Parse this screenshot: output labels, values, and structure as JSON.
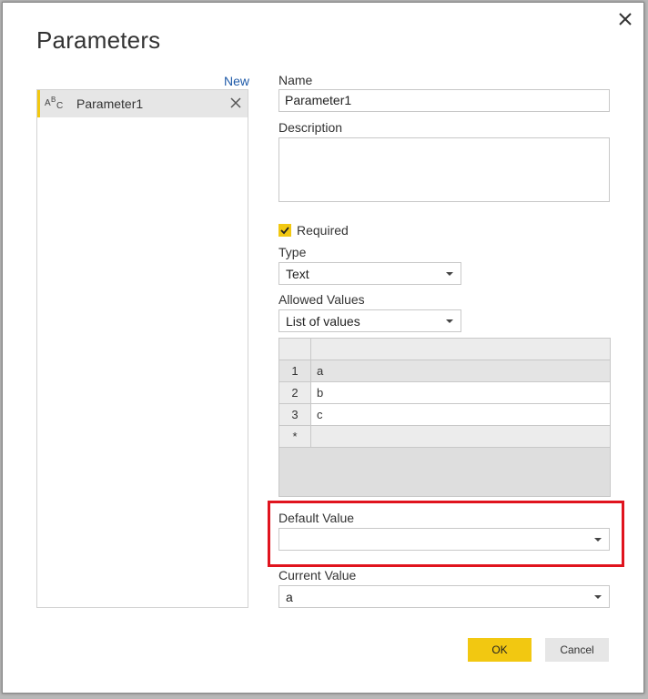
{
  "dialog": {
    "title": "Parameters",
    "new_link": "New"
  },
  "parameters": [
    {
      "name": "Parameter1",
      "type_icon": "text-type-icon",
      "icon_text": [
        "A",
        "B",
        "C"
      ]
    }
  ],
  "form": {
    "name_label": "Name",
    "name_value": "Parameter1",
    "description_label": "Description",
    "description_value": "",
    "required_label": "Required",
    "required_checked": true,
    "type_label": "Type",
    "type_value": "Text",
    "allowed_values_label": "Allowed Values",
    "allowed_values_value": "List of values",
    "values_grid": {
      "rows": [
        {
          "num": "1",
          "value": "a",
          "selected": true
        },
        {
          "num": "2",
          "value": "b"
        },
        {
          "num": "3",
          "value": "c"
        },
        {
          "num": "*",
          "value": ""
        }
      ]
    },
    "default_value_label": "Default Value",
    "default_value": "",
    "current_value_label": "Current Value",
    "current_value": "a"
  },
  "buttons": {
    "ok": "OK",
    "cancel": "Cancel"
  },
  "colors": {
    "accent": "#f2c811",
    "highlight": "#e0141e",
    "link": "#1e5aa8"
  }
}
